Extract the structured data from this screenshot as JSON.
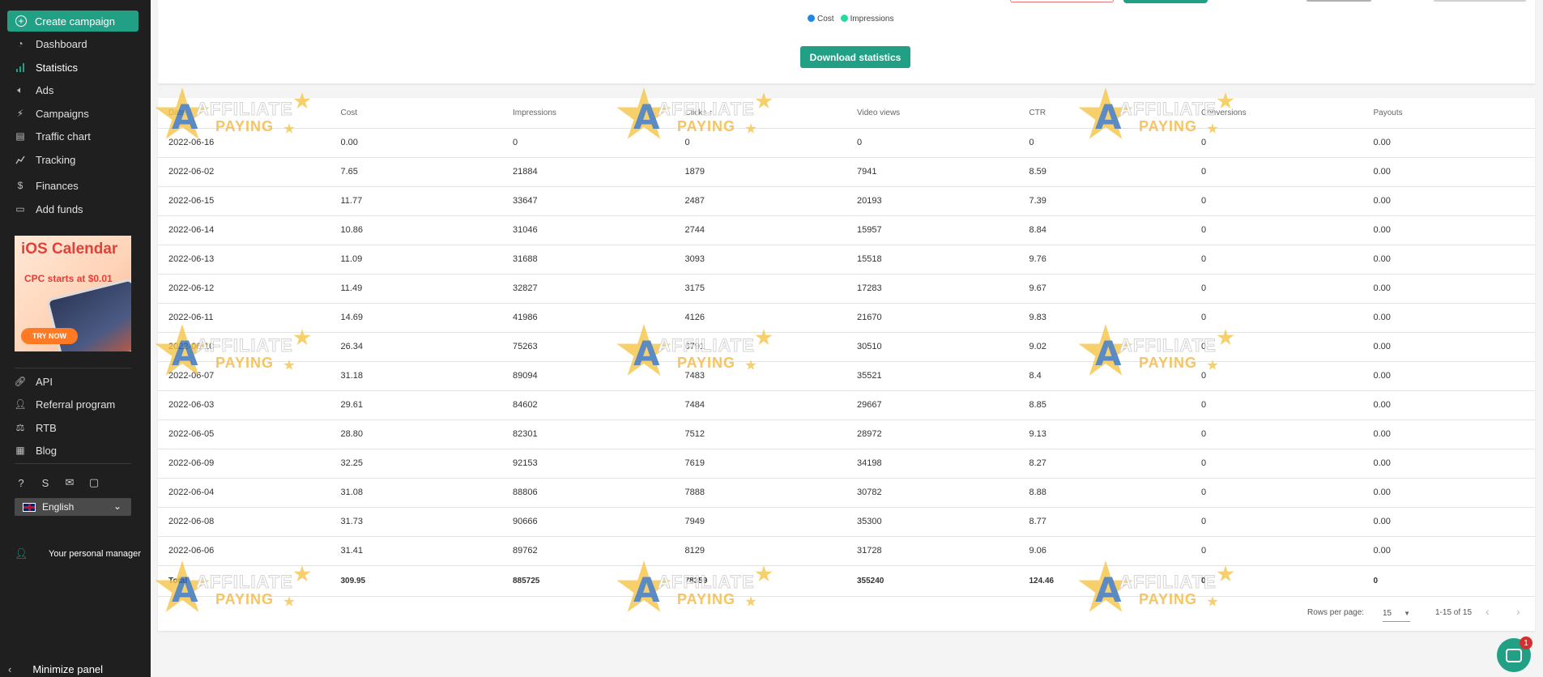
{
  "sidebar": {
    "create_label": "Create campaign",
    "items": [
      {
        "label": "Dashboard",
        "icon": "dashboard-icon"
      },
      {
        "label": "Statistics",
        "icon": "bar-chart-icon"
      },
      {
        "label": "Ads",
        "icon": "speaker-icon"
      },
      {
        "label": "Campaigns",
        "icon": "campaigns-icon"
      },
      {
        "label": "Traffic chart",
        "icon": "document-icon"
      },
      {
        "label": "Tracking",
        "icon": "line-chart-icon"
      },
      {
        "label": "Finances",
        "icon": "dollar-icon"
      },
      {
        "label": "Add funds",
        "icon": "card-icon"
      }
    ],
    "promo": {
      "title": "iOS Calendar",
      "subtitle": "CPC starts at $0.01",
      "cta": "TRY NOW"
    },
    "items2": [
      {
        "label": "API",
        "icon": "link-icon"
      },
      {
        "label": "Referral program",
        "icon": "user-plus-icon"
      },
      {
        "label": "RTB",
        "icon": "scale-icon"
      },
      {
        "label": "Blog",
        "icon": "blog-icon"
      }
    ],
    "language": "English",
    "manager": "Your personal manager",
    "minimize": "Minimize panel"
  },
  "chart_legend": {
    "cost": "Cost",
    "impressions": "Impressions"
  },
  "colors": {
    "accent": "#22a085",
    "cost": "#1e88e5",
    "impressions": "#26d9a0"
  },
  "download_label": "Download statistics",
  "table": {
    "columns": [
      "Date",
      "Cost",
      "Impressions",
      "Clicks ↑",
      "Video views",
      "CTR",
      "Conversions",
      "Payouts"
    ],
    "rows": [
      [
        "2022-06-16",
        "0.00",
        "0",
        "0",
        "0",
        "0",
        "0",
        "0.00"
      ],
      [
        "2022-06-02",
        "7.65",
        "21884",
        "1879",
        "7941",
        "8.59",
        "0",
        "0.00"
      ],
      [
        "2022-06-15",
        "11.77",
        "33647",
        "2487",
        "20193",
        "7.39",
        "0",
        "0.00"
      ],
      [
        "2022-06-14",
        "10.86",
        "31046",
        "2744",
        "15957",
        "8.84",
        "0",
        "0.00"
      ],
      [
        "2022-06-13",
        "11.09",
        "31688",
        "3093",
        "15518",
        "9.76",
        "0",
        "0.00"
      ],
      [
        "2022-06-12",
        "11.49",
        "32827",
        "3175",
        "17283",
        "9.67",
        "0",
        "0.00"
      ],
      [
        "2022-06-11",
        "14.69",
        "41986",
        "4126",
        "21670",
        "9.83",
        "0",
        "0.00"
      ],
      [
        "2022-06-10",
        "26.34",
        "75263",
        "6791",
        "30510",
        "9.02",
        "0",
        "0.00"
      ],
      [
        "2022-06-07",
        "31.18",
        "89094",
        "7483",
        "35521",
        "8.4",
        "0",
        "0.00"
      ],
      [
        "2022-06-03",
        "29.61",
        "84602",
        "7484",
        "29667",
        "8.85",
        "0",
        "0.00"
      ],
      [
        "2022-06-05",
        "28.80",
        "82301",
        "7512",
        "28972",
        "9.13",
        "0",
        "0.00"
      ],
      [
        "2022-06-09",
        "32.25",
        "92153",
        "7619",
        "34198",
        "8.27",
        "0",
        "0.00"
      ],
      [
        "2022-06-04",
        "31.08",
        "88806",
        "7888",
        "30782",
        "8.88",
        "0",
        "0.00"
      ],
      [
        "2022-06-08",
        "31.73",
        "90666",
        "7949",
        "35300",
        "8.77",
        "0",
        "0.00"
      ],
      [
        "2022-06-06",
        "31.41",
        "89762",
        "8129",
        "31728",
        "9.06",
        "0",
        "0.00"
      ]
    ],
    "total": [
      "Total",
      "309.95",
      "885725",
      "78359",
      "355240",
      "124.46",
      "0",
      "0"
    ]
  },
  "pagination": {
    "rows_per_page_label": "Rows per page:",
    "rows_per_page": "15",
    "range": "1-15 of 15"
  },
  "watermark": {
    "letter": "A",
    "word1": "AFFILIATE",
    "word2": "PAYING"
  },
  "chat": {
    "badge": "1"
  }
}
